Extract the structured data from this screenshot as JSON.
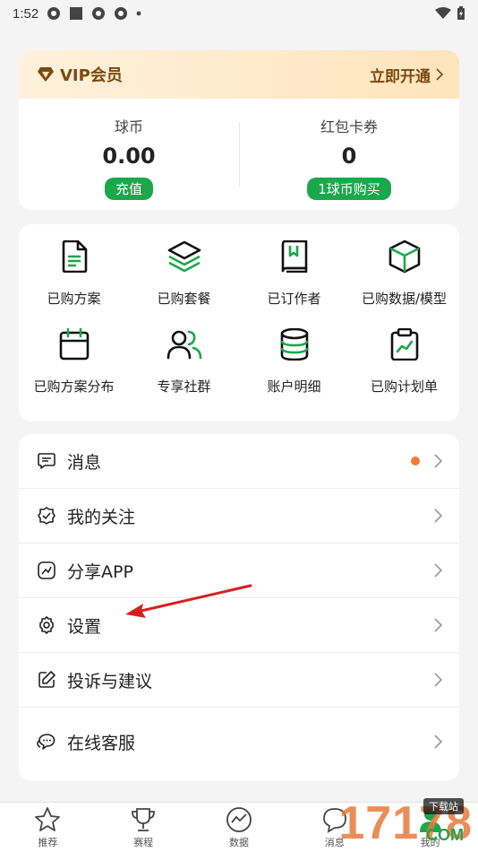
{
  "status_bar": {
    "time": "1:52"
  },
  "vip": {
    "title": "VIP会员",
    "action": "立即开通"
  },
  "wallet": [
    {
      "label": "球币",
      "value": "0.00",
      "button": "充值"
    },
    {
      "label": "红包卡券",
      "value": "0",
      "button": "1球币购买"
    }
  ],
  "grid": [
    {
      "label": "已购方案",
      "icon": "document-icon"
    },
    {
      "label": "已购套餐",
      "icon": "layers-icon"
    },
    {
      "label": "已订作者",
      "icon": "bookmark-book-icon"
    },
    {
      "label": "已购数据/模型",
      "icon": "cube-icon"
    },
    {
      "label": "已购方案分布",
      "icon": "calendar-icon"
    },
    {
      "label": "专享社群",
      "icon": "group-icon"
    },
    {
      "label": "账户明细",
      "icon": "database-icon"
    },
    {
      "label": "已购计划单",
      "icon": "clipboard-chart-icon"
    }
  ],
  "menu": [
    {
      "label": "消息",
      "icon": "message-icon",
      "dot": true
    },
    {
      "label": "我的关注",
      "icon": "badge-check-icon",
      "dot": false
    },
    {
      "label": "分享APP",
      "icon": "share-icon",
      "dot": false
    },
    {
      "label": "设置",
      "icon": "gear-icon",
      "dot": false
    },
    {
      "label": "投诉与建议",
      "icon": "edit-icon",
      "dot": false
    },
    {
      "label": "在线客服",
      "icon": "chat-icon",
      "dot": false
    }
  ],
  "nav": [
    {
      "label": "推荐",
      "icon": "star-icon"
    },
    {
      "label": "赛程",
      "icon": "trophy-icon"
    },
    {
      "label": "数据",
      "icon": "trend-icon"
    },
    {
      "label": "消息",
      "icon": "chat-bubble-icon"
    },
    {
      "label": "我的",
      "icon": "user-icon"
    }
  ],
  "watermark": {
    "text": "17178",
    "badge": "下载站",
    "suffix": "COM"
  },
  "colors": {
    "accent_green": "#1aa84b",
    "vip_brown": "#7a4a10",
    "notification_dot": "#f47a35"
  }
}
